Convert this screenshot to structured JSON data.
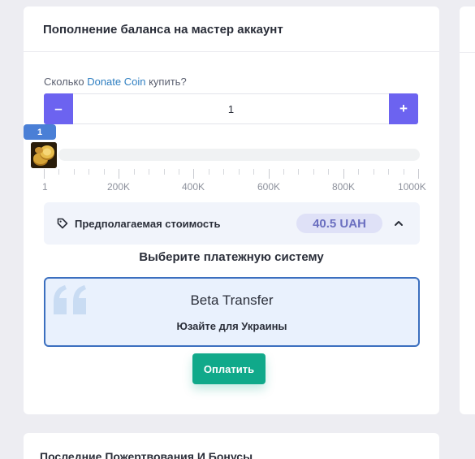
{
  "topup": {
    "title": "Пополнение баланса на мастер аккаунт",
    "question_prefix": "Сколько ",
    "question_accent": "Donate Coin",
    "question_suffix": " купить?",
    "minus_label": "–",
    "plus_label": "+",
    "quantity": "1",
    "slider": {
      "value_badge": "1",
      "value": 1,
      "min": 1,
      "max": 1000000,
      "tick_labels": [
        "1",
        "200K",
        "400K",
        "600K",
        "800K",
        "1000K"
      ]
    },
    "estimate": {
      "label": "Предполагаемая стоимость",
      "price": "40.5 UAH",
      "icon": "tag-icon",
      "toggle_icon": "chevron-up-icon"
    },
    "payment": {
      "heading": "Выберите платежную систему",
      "method_name": "Beta Transfer",
      "method_note": "Юзайте для Украины",
      "icon": "quote-icon"
    },
    "pay_button": "Оплатить"
  },
  "recent": {
    "title": "Последние Пожертвования И Бонусы"
  },
  "colors": {
    "accent": "#6c63f0",
    "link": "#2f7fc1",
    "pay_button": "#10a98a",
    "price_pill_bg": "#dfe1f7",
    "selected_border": "#3b6fbf"
  }
}
